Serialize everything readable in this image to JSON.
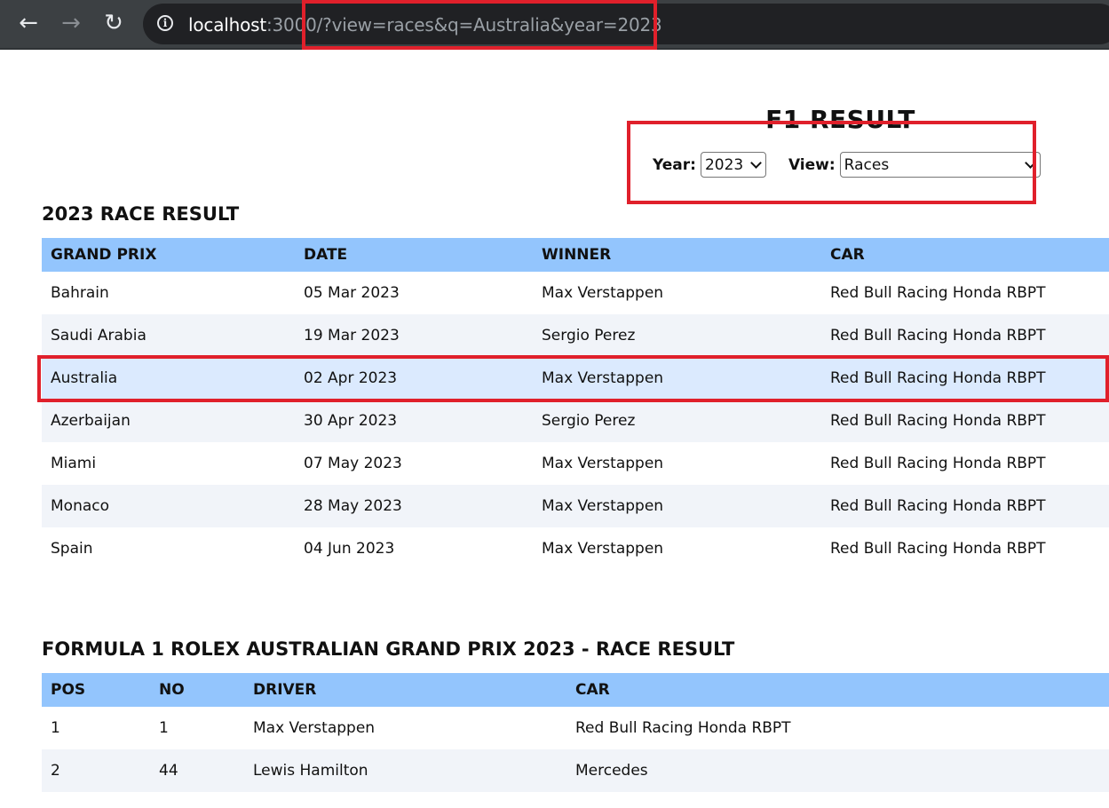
{
  "browser": {
    "url_host": "localhost",
    "url_rest": ":3000/?view=races&q=Australia&year=2023"
  },
  "page": {
    "title": "F1 RESULT"
  },
  "controls": {
    "year_label": "Year:",
    "year_value": "2023",
    "view_label": "View:",
    "view_value": "Races"
  },
  "races_table": {
    "title": "2023 RACE RESULT",
    "headers": [
      "GRAND PRIX",
      "DATE",
      "WINNER",
      "CAR"
    ],
    "rows": [
      [
        "Bahrain",
        "05 Mar 2023",
        "Max Verstappen",
        "Red Bull Racing Honda RBPT"
      ],
      [
        "Saudi Arabia",
        "19 Mar 2023",
        "Sergio Perez",
        "Red Bull Racing Honda RBPT"
      ],
      [
        "Australia",
        "02 Apr 2023",
        "Max Verstappen",
        "Red Bull Racing Honda RBPT"
      ],
      [
        "Azerbaijan",
        "30 Apr 2023",
        "Sergio Perez",
        "Red Bull Racing Honda RBPT"
      ],
      [
        "Miami",
        "07 May 2023",
        "Max Verstappen",
        "Red Bull Racing Honda RBPT"
      ],
      [
        "Monaco",
        "28 May 2023",
        "Max Verstappen",
        "Red Bull Racing Honda RBPT"
      ],
      [
        "Spain",
        "04 Jun 2023",
        "Max Verstappen",
        "Red Bull Racing Honda RBPT"
      ]
    ]
  },
  "race_detail": {
    "title": "FORMULA 1 ROLEX AUSTRALIAN GRAND PRIX 2023 - RACE RESULT",
    "headers": [
      "POS",
      "NO",
      "DRIVER",
      "CAR"
    ],
    "rows": [
      [
        "1",
        "1",
        "Max Verstappen",
        "Red Bull Racing Honda RBPT"
      ],
      [
        "2",
        "44",
        "Lewis Hamilton",
        "Mercedes"
      ]
    ]
  },
  "colors": {
    "header_bg": "#93c5fd",
    "highlight": "#e0202b",
    "selected_row": "#dbeafe"
  }
}
